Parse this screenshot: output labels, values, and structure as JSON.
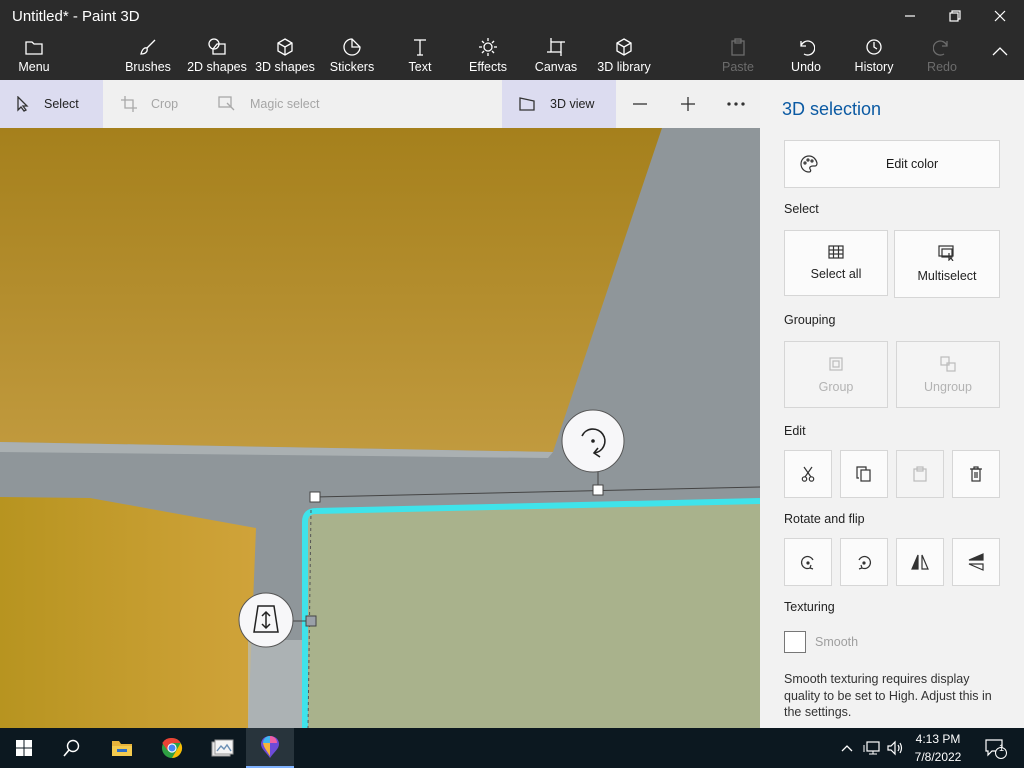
{
  "window": {
    "title": "Untitled* - Paint 3D"
  },
  "ribbon": {
    "menu": "Menu",
    "brushes": "Brushes",
    "shapes2d": "2D shapes",
    "shapes3d": "3D shapes",
    "stickers": "Stickers",
    "text": "Text",
    "effects": "Effects",
    "canvas": "Canvas",
    "library3d": "3D library",
    "paste": "Paste",
    "undo": "Undo",
    "history": "History",
    "redo": "Redo"
  },
  "toolbar": {
    "select": "Select",
    "crop": "Crop",
    "magic_select": "Magic select",
    "view3d": "3D view"
  },
  "panel": {
    "title": "3D selection",
    "edit_color": "Edit color",
    "select_section": "Select",
    "select_all": "Select all",
    "multiselect": "Multiselect",
    "grouping_section": "Grouping",
    "group": "Group",
    "ungroup": "Ungroup",
    "edit_section": "Edit",
    "rotate_section": "Rotate and flip",
    "texturing_section": "Texturing",
    "smooth": "Smooth",
    "smooth_checked": false,
    "help_text": "Smooth texturing requires display quality to be set to High. Adjust this in the settings."
  },
  "taskbar": {
    "time": "4:13 PM",
    "date": "7/8/2022",
    "notification_count": "1"
  },
  "colors": {
    "accent": "#0b5aa3",
    "selection_outline": "#3fe3ea",
    "shape_green": "#a9b28c",
    "shape_gold": "#b78d22",
    "shape_orange": "#c99a2e",
    "canvas_gray": "#8f969a"
  }
}
